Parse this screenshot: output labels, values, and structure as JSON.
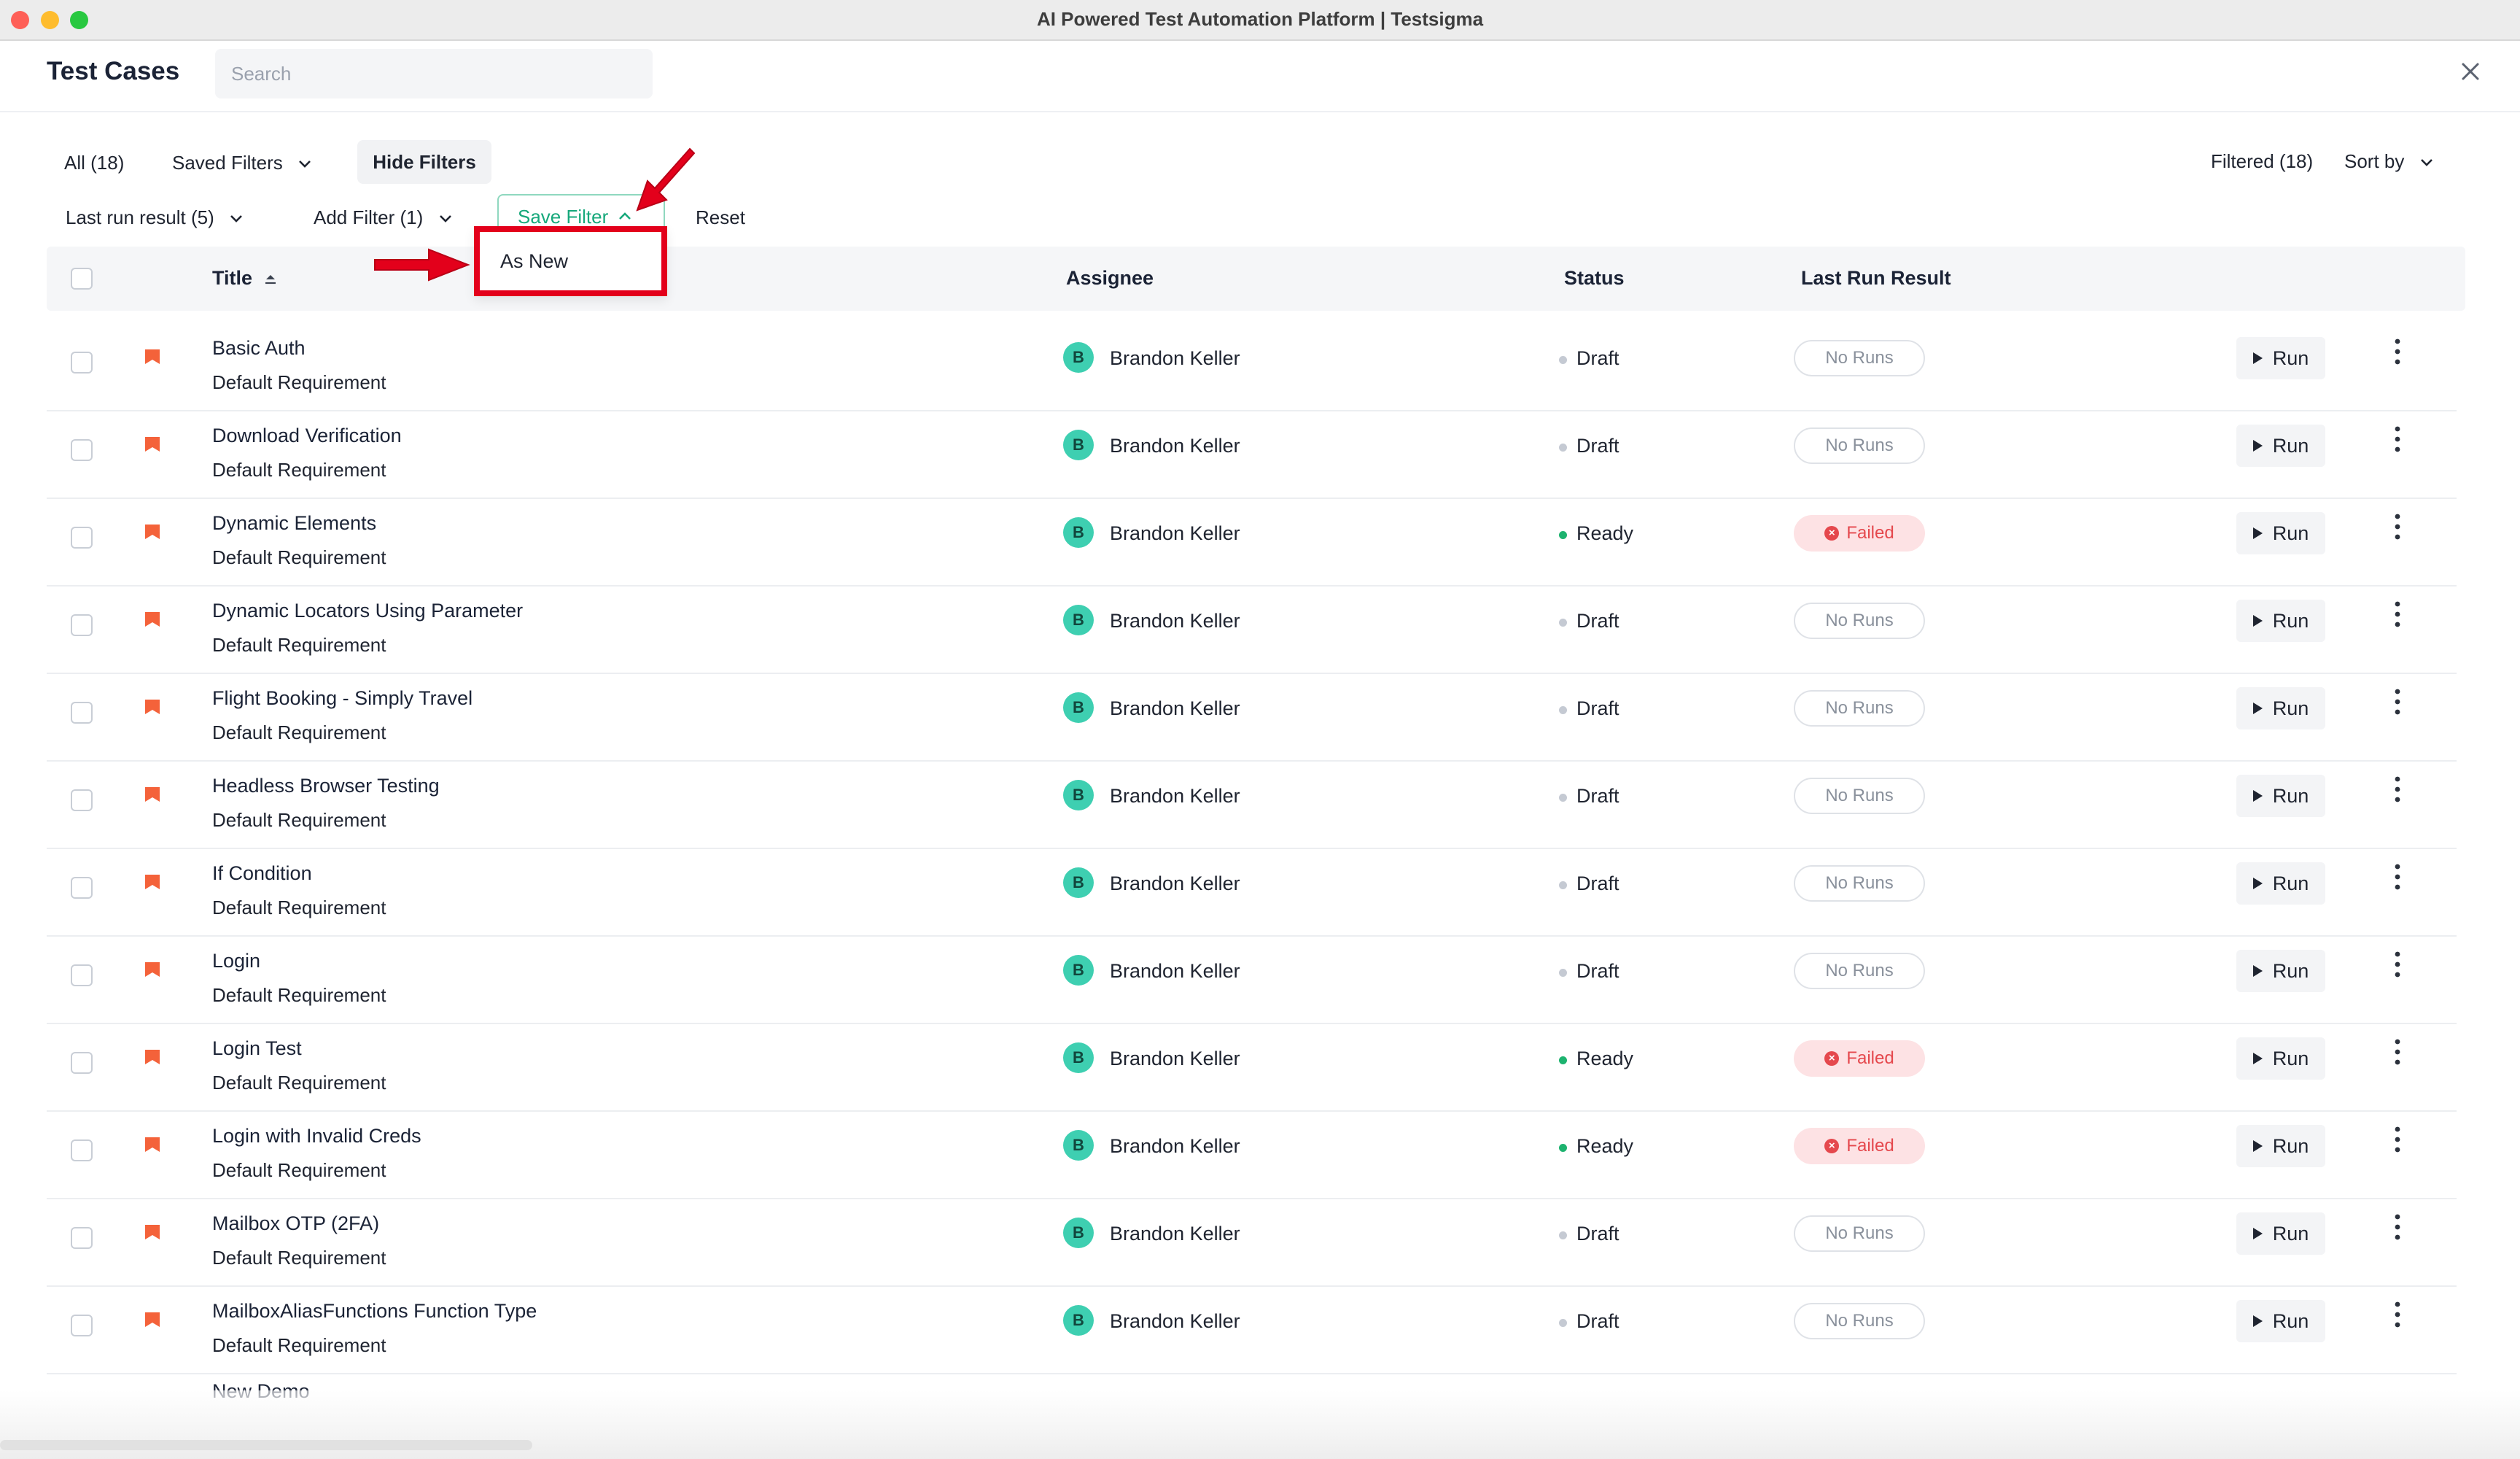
{
  "window": {
    "title": "AI Powered Test Automation Platform | Testsigma"
  },
  "header": {
    "title": "Test Cases",
    "search_placeholder": "Search"
  },
  "toolbar": {
    "all_label": "All (18)",
    "saved_filters_label": "Saved Filters",
    "hide_filters_label": "Hide Filters",
    "filtered_label": "Filtered (18)",
    "sort_by_label": "Sort by",
    "last_run_result_label": "Last run result (5)",
    "add_filter_label": "Add Filter (1)",
    "save_filter_label": "Save Filter",
    "reset_label": "Reset"
  },
  "save_filter_menu": {
    "items": [
      "As New"
    ]
  },
  "table": {
    "columns": {
      "title": "Title",
      "assignee": "Assignee",
      "status": "Status",
      "last_run_result": "Last Run Result"
    },
    "run_label": "Run",
    "rows": [
      {
        "title": "Basic Auth",
        "requirement": "Default Requirement",
        "avatar": "B",
        "assignee": "Brandon Keller",
        "status": "Draft",
        "result": "No Runs"
      },
      {
        "title": "Download Verification",
        "requirement": "Default Requirement",
        "avatar": "B",
        "assignee": "Brandon Keller",
        "status": "Draft",
        "result": "No Runs"
      },
      {
        "title": "Dynamic Elements",
        "requirement": "Default Requirement",
        "avatar": "B",
        "assignee": "Brandon Keller",
        "status": "Ready",
        "result": "Failed"
      },
      {
        "title": "Dynamic Locators Using Parameter",
        "requirement": "Default Requirement",
        "avatar": "B",
        "assignee": "Brandon Keller",
        "status": "Draft",
        "result": "No Runs"
      },
      {
        "title": "Flight Booking - Simply Travel",
        "requirement": "Default Requirement",
        "avatar": "B",
        "assignee": "Brandon Keller",
        "status": "Draft",
        "result": "No Runs"
      },
      {
        "title": "Headless Browser Testing",
        "requirement": "Default Requirement",
        "avatar": "B",
        "assignee": "Brandon Keller",
        "status": "Draft",
        "result": "No Runs"
      },
      {
        "title": "If Condition",
        "requirement": "Default Requirement",
        "avatar": "B",
        "assignee": "Brandon Keller",
        "status": "Draft",
        "result": "No Runs"
      },
      {
        "title": "Login",
        "requirement": "Default Requirement",
        "avatar": "B",
        "assignee": "Brandon Keller",
        "status": "Draft",
        "result": "No Runs"
      },
      {
        "title": "Login Test",
        "requirement": "Default Requirement",
        "avatar": "B",
        "assignee": "Brandon Keller",
        "status": "Ready",
        "result": "Failed"
      },
      {
        "title": "Login with Invalid Creds",
        "requirement": "Default Requirement",
        "avatar": "B",
        "assignee": "Brandon Keller",
        "status": "Ready",
        "result": "Failed"
      },
      {
        "title": "Mailbox OTP (2FA)",
        "requirement": "Default Requirement",
        "avatar": "B",
        "assignee": "Brandon Keller",
        "status": "Draft",
        "result": "No Runs"
      },
      {
        "title": "MailboxAliasFunctions Function Type",
        "requirement": "Default Requirement",
        "avatar": "B",
        "assignee": "Brandon Keller",
        "status": "Draft",
        "result": "No Runs"
      }
    ],
    "partial_row_title": "New Demo"
  },
  "colors": {
    "accent_green": "#17a87b",
    "avatar_teal": "#3ecfb1",
    "ready_dot": "#1db36f",
    "draft_dot": "#c5cad3",
    "failed_red": "#e5484d",
    "flag_orange": "#f4623a",
    "annotation_red": "#e3001b"
  }
}
